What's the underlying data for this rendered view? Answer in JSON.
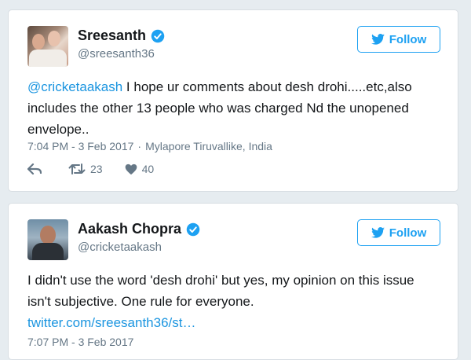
{
  "tweets": [
    {
      "display_name": "Sreesanth",
      "handle": "@sreesanth36",
      "follow_label": "Follow",
      "mention": "@cricketaakash",
      "text_before": "",
      "text_after": " I hope ur comments about desh drohi.....etc,also includes the other 13 people who was charged Nd the unopened envelope..",
      "time": "7:04 PM - 3 Feb 2017",
      "location": "Mylapore Tiruvallike, India",
      "retweets": "23",
      "likes": "40"
    },
    {
      "display_name": "Aakash Chopra",
      "handle": "@cricketaakash",
      "follow_label": "Follow",
      "text": "I didn't use the word 'desh drohi' but yes, my opinion on this issue isn't subjective. One rule for everyone.",
      "link": "twitter.com/sreesanth36/st…",
      "time": "7:07 PM - 3 Feb 2017"
    }
  ],
  "meta_separator": "·",
  "colors": {
    "accent": "#1da1f2",
    "link": "#1b95e0",
    "muted": "#657786",
    "background": "#e6ecf0"
  },
  "icons": [
    "verified-badge-icon",
    "twitter-bird-icon",
    "reply-icon",
    "retweet-icon",
    "heart-icon"
  ]
}
